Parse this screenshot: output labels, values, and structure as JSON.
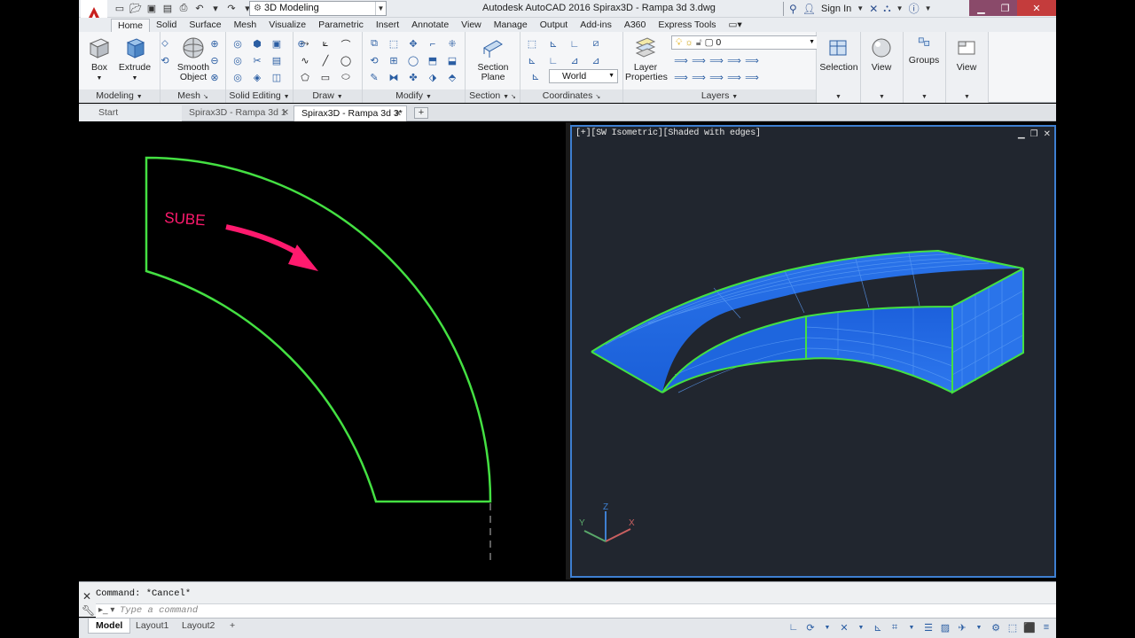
{
  "window": {
    "title": "Autodesk AutoCAD 2016   Spirax3D - Rampa 3d 3.dwg",
    "workspace": "3D Modeling",
    "sign_in": "Sign In"
  },
  "ribbon_tabs": [
    "Home",
    "Solid",
    "Surface",
    "Mesh",
    "Visualize",
    "Parametric",
    "Insert",
    "Annotate",
    "View",
    "Manage",
    "Output",
    "Add-ins",
    "A360",
    "Express Tools"
  ],
  "ribbon": {
    "box_label": "Box",
    "extrude_label": "Extrude",
    "smooth_object_label_1": "Smooth",
    "smooth_object_label_2": "Object",
    "section_plane_label_1": "Section",
    "section_plane_label_2": "Plane",
    "layer_properties_label_1": "Layer",
    "layer_properties_label_2": "Properties",
    "layer_current": "0",
    "coord_world": "World",
    "selection_label": "Selection",
    "view_label": "View",
    "groups_label": "Groups",
    "view2_label": "View",
    "panels": {
      "modeling": "Modeling",
      "mesh": "Mesh",
      "solid_editing": "Solid Editing",
      "draw": "Draw",
      "modify": "Modify",
      "section": "Section",
      "coordinates": "Coordinates",
      "layers": "Layers"
    }
  },
  "file_tabs": {
    "start": "Start",
    "tab1": "Spirax3D - Rampa 3d 1",
    "tab2": "Spirax3D - Rampa 3d 3*"
  },
  "viewport_left": {
    "annotation": "SUBE"
  },
  "viewport_right": {
    "label": "[+][SW Isometric][Shaded with edges]",
    "ucs_x": "X",
    "ucs_y": "Y",
    "ucs_z": "Z"
  },
  "command": {
    "history": "Command: *Cancel*",
    "placeholder": "Type a command"
  },
  "layout_tabs": {
    "model": "Model",
    "layout1": "Layout1",
    "layout2": "Layout2",
    "add": "+"
  },
  "colors": {
    "outline_green": "#44e042",
    "arrow_pink": "#ff1a6e",
    "solid_blue": "#1a64e0",
    "viewport_border": "#3e7fd1"
  }
}
